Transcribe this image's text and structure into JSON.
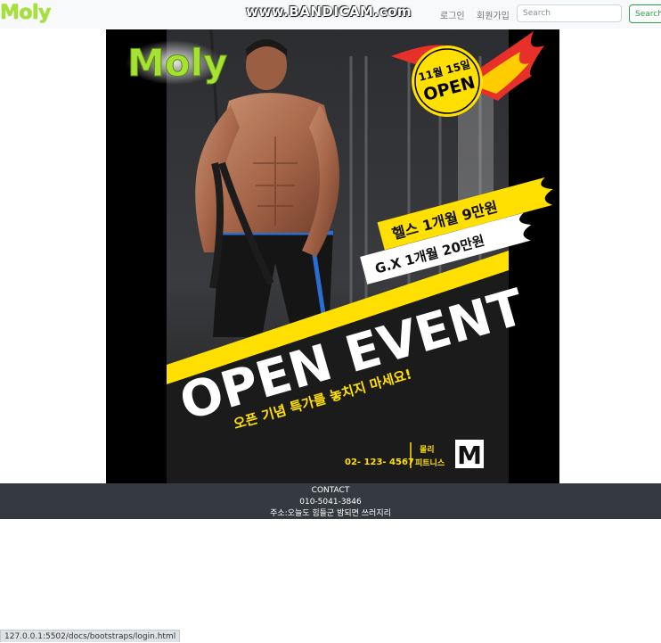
{
  "navbar": {
    "brand": "Moly",
    "watermark": "www.BANDICAM.com",
    "links": [
      {
        "label": "로그인"
      },
      {
        "label": "회원가입"
      }
    ],
    "search": {
      "placeholder": "Search",
      "button_label": "Search"
    }
  },
  "poster": {
    "logo_text": "Moly",
    "open_badge_date": "11월 15일",
    "open_badge_word": "OPEN",
    "price_health": "헬스 1개월 9만원",
    "price_gx": "G.X 1개월 20만원",
    "headline": "OPEN EVENT",
    "subline": "오픈 기념 특가를 놓치지 마세요!",
    "phone": "02- 123- 4567",
    "gym_name_line1": "몰리",
    "gym_name_line2": "피트니스",
    "gym_logo_letter": "M",
    "colors": {
      "accent": "#ffe000",
      "brand_green": "#a6e234",
      "flame": "#e8302a"
    }
  },
  "footer": {
    "title": "CONTACT",
    "phone": "010-5041-3846",
    "address": "주소:오늘도 힘들군 밤되면 쓰러지리"
  },
  "statusbar": {
    "url": "127.0.0.1:5502/docs/bootstraps/login.html"
  }
}
